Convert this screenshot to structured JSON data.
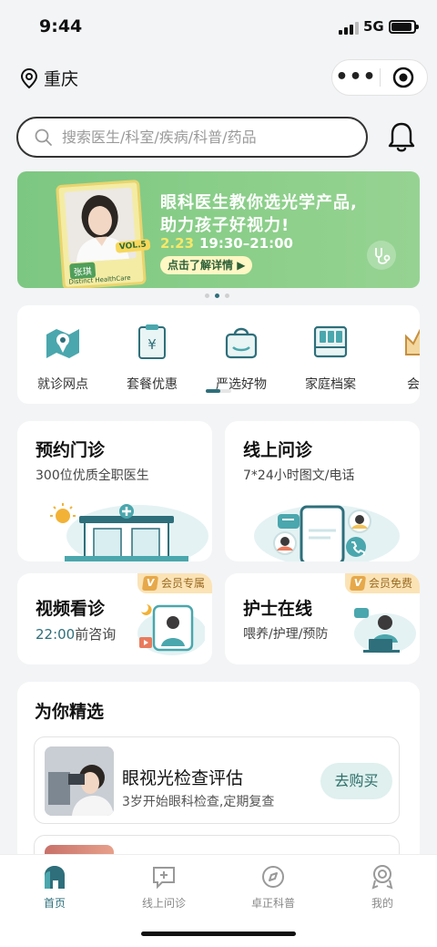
{
  "status_bar": {
    "time": "9:44",
    "network": "5G"
  },
  "location": {
    "city": "重庆"
  },
  "capsule": {
    "more": "•••"
  },
  "search": {
    "placeholder": "搜索医生/科室/疾病/科普/药品"
  },
  "banner": {
    "title_line1": "眼科医生教你选光学产品,",
    "title_line2": "助力孩子好视力!",
    "date": "2.23",
    "time": "19:30–21:00",
    "cta": "点击了解详情",
    "doctor_name": "张琪",
    "vol_tag": "VOL.5",
    "brand": "Distinct HealthCare"
  },
  "services": [
    {
      "label": "就诊网点",
      "icon": "map-icon"
    },
    {
      "label": "套餐优惠",
      "icon": "voucher-icon"
    },
    {
      "label": "严选好物",
      "icon": "shopping-bag-icon"
    },
    {
      "label": "家庭档案",
      "icon": "file-cabinet-icon"
    },
    {
      "label": "会员",
      "icon": "crown-icon"
    }
  ],
  "cards": {
    "appointment": {
      "title": "预约门诊",
      "subtitle": "300位优质全职医生"
    },
    "online": {
      "title": "线上问诊",
      "subtitle": "7*24小时图文/电话"
    },
    "video": {
      "title": "视频看诊",
      "subtitle_time": "22:00",
      "subtitle_rest": "前咨询",
      "badge": "会员专属",
      "badge_mark": "V"
    },
    "nurse": {
      "title": "护士在线",
      "subtitle": "喂养/护理/预防",
      "badge": "会员免费",
      "badge_mark": "V"
    }
  },
  "recommend": {
    "title": "为你精选",
    "items": [
      {
        "name": "眼视光检查评估",
        "desc": "3岁开始眼科检查,定期复查",
        "button": "去购买"
      }
    ]
  },
  "tabbar": [
    {
      "label": "首页",
      "icon": "home-icon",
      "active": true
    },
    {
      "label": "线上问诊",
      "icon": "chat-plus-icon",
      "active": false
    },
    {
      "label": "卓正科普",
      "icon": "compass-icon",
      "active": false
    },
    {
      "label": "我的",
      "icon": "profile-icon",
      "active": false
    }
  ],
  "colors": {
    "primary": "#2e6f7b",
    "banner_green": "#8ccf8a",
    "badge_bg": "#fbe3b6"
  }
}
